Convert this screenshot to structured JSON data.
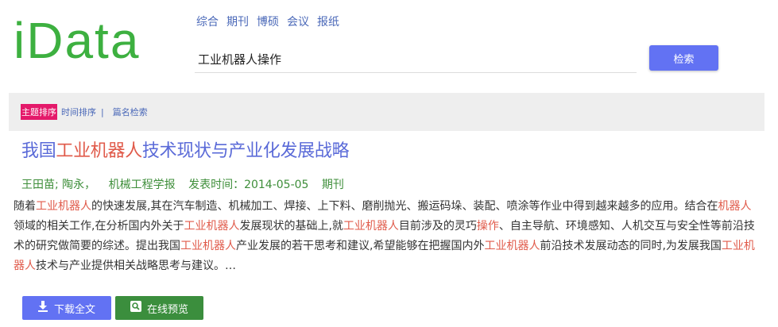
{
  "logo": {
    "text": "iData"
  },
  "category_nav": [
    {
      "label": "综合"
    },
    {
      "label": "期刊"
    },
    {
      "label": "博硕"
    },
    {
      "label": "会议"
    },
    {
      "label": "报纸"
    }
  ],
  "search": {
    "value": "工业机器人操作",
    "button_label": "检索"
  },
  "sort_bar": {
    "active": "主题排序",
    "time": "时间排序",
    "separator": "|",
    "title_search": "篇名检索"
  },
  "result": {
    "title_parts": [
      {
        "text": "我国",
        "highlight": false
      },
      {
        "text": "工业机器人",
        "highlight": true
      },
      {
        "text": "技术现状与产业化发展战略",
        "highlight": false
      }
    ],
    "authors": "王田苗; 陶永，",
    "journal": "机械工程学报",
    "published": "发表时间：2014-05-05",
    "type": "期刊",
    "abstract_parts": [
      {
        "text": "随着",
        "highlight": false
      },
      {
        "text": "工业机器人",
        "highlight": true
      },
      {
        "text": "的快速发展,其在汽车制造、机械加工、焊接、上下料、磨削抛光、搬运码垛、装配、喷涂等作业中得到越来越多的应用。结合在",
        "highlight": false
      },
      {
        "text": "机器人",
        "highlight": true
      },
      {
        "text": "领域的相关工作,在分析国内外关于",
        "highlight": false
      },
      {
        "text": "工业机器人",
        "highlight": true
      },
      {
        "text": "发展现状的基础上,就",
        "highlight": false
      },
      {
        "text": "工业机器人",
        "highlight": true
      },
      {
        "text": "目前涉及的灵巧",
        "highlight": false
      },
      {
        "text": "操作",
        "highlight": true
      },
      {
        "text": "、自主导航、环境感知、人机交互与安全性等前沿技术的研究做简要的综述。提出我国",
        "highlight": false
      },
      {
        "text": "工业机器人",
        "highlight": true
      },
      {
        "text": "产业发展的若干思考和建议,希望能够在把握国内外",
        "highlight": false
      },
      {
        "text": "工业机器人",
        "highlight": true
      },
      {
        "text": "前沿技术发展动态的同时,为发展我国",
        "highlight": false
      },
      {
        "text": "工业机器人",
        "highlight": true
      },
      {
        "text": "技术与产业提供相关战略思考与建议。…",
        "highlight": false
      }
    ],
    "download_label": "下载全文",
    "preview_label": "在线预览"
  },
  "icons": {
    "download": "download-icon",
    "preview": "magnifier-icon"
  },
  "colors": {
    "logo": "#3db040",
    "accent": "#6272f3",
    "highlight": "#e05a4a",
    "sort_active": "#e4196a",
    "meta": "#3e8e3a",
    "preview_button": "#3b8e3d"
  }
}
